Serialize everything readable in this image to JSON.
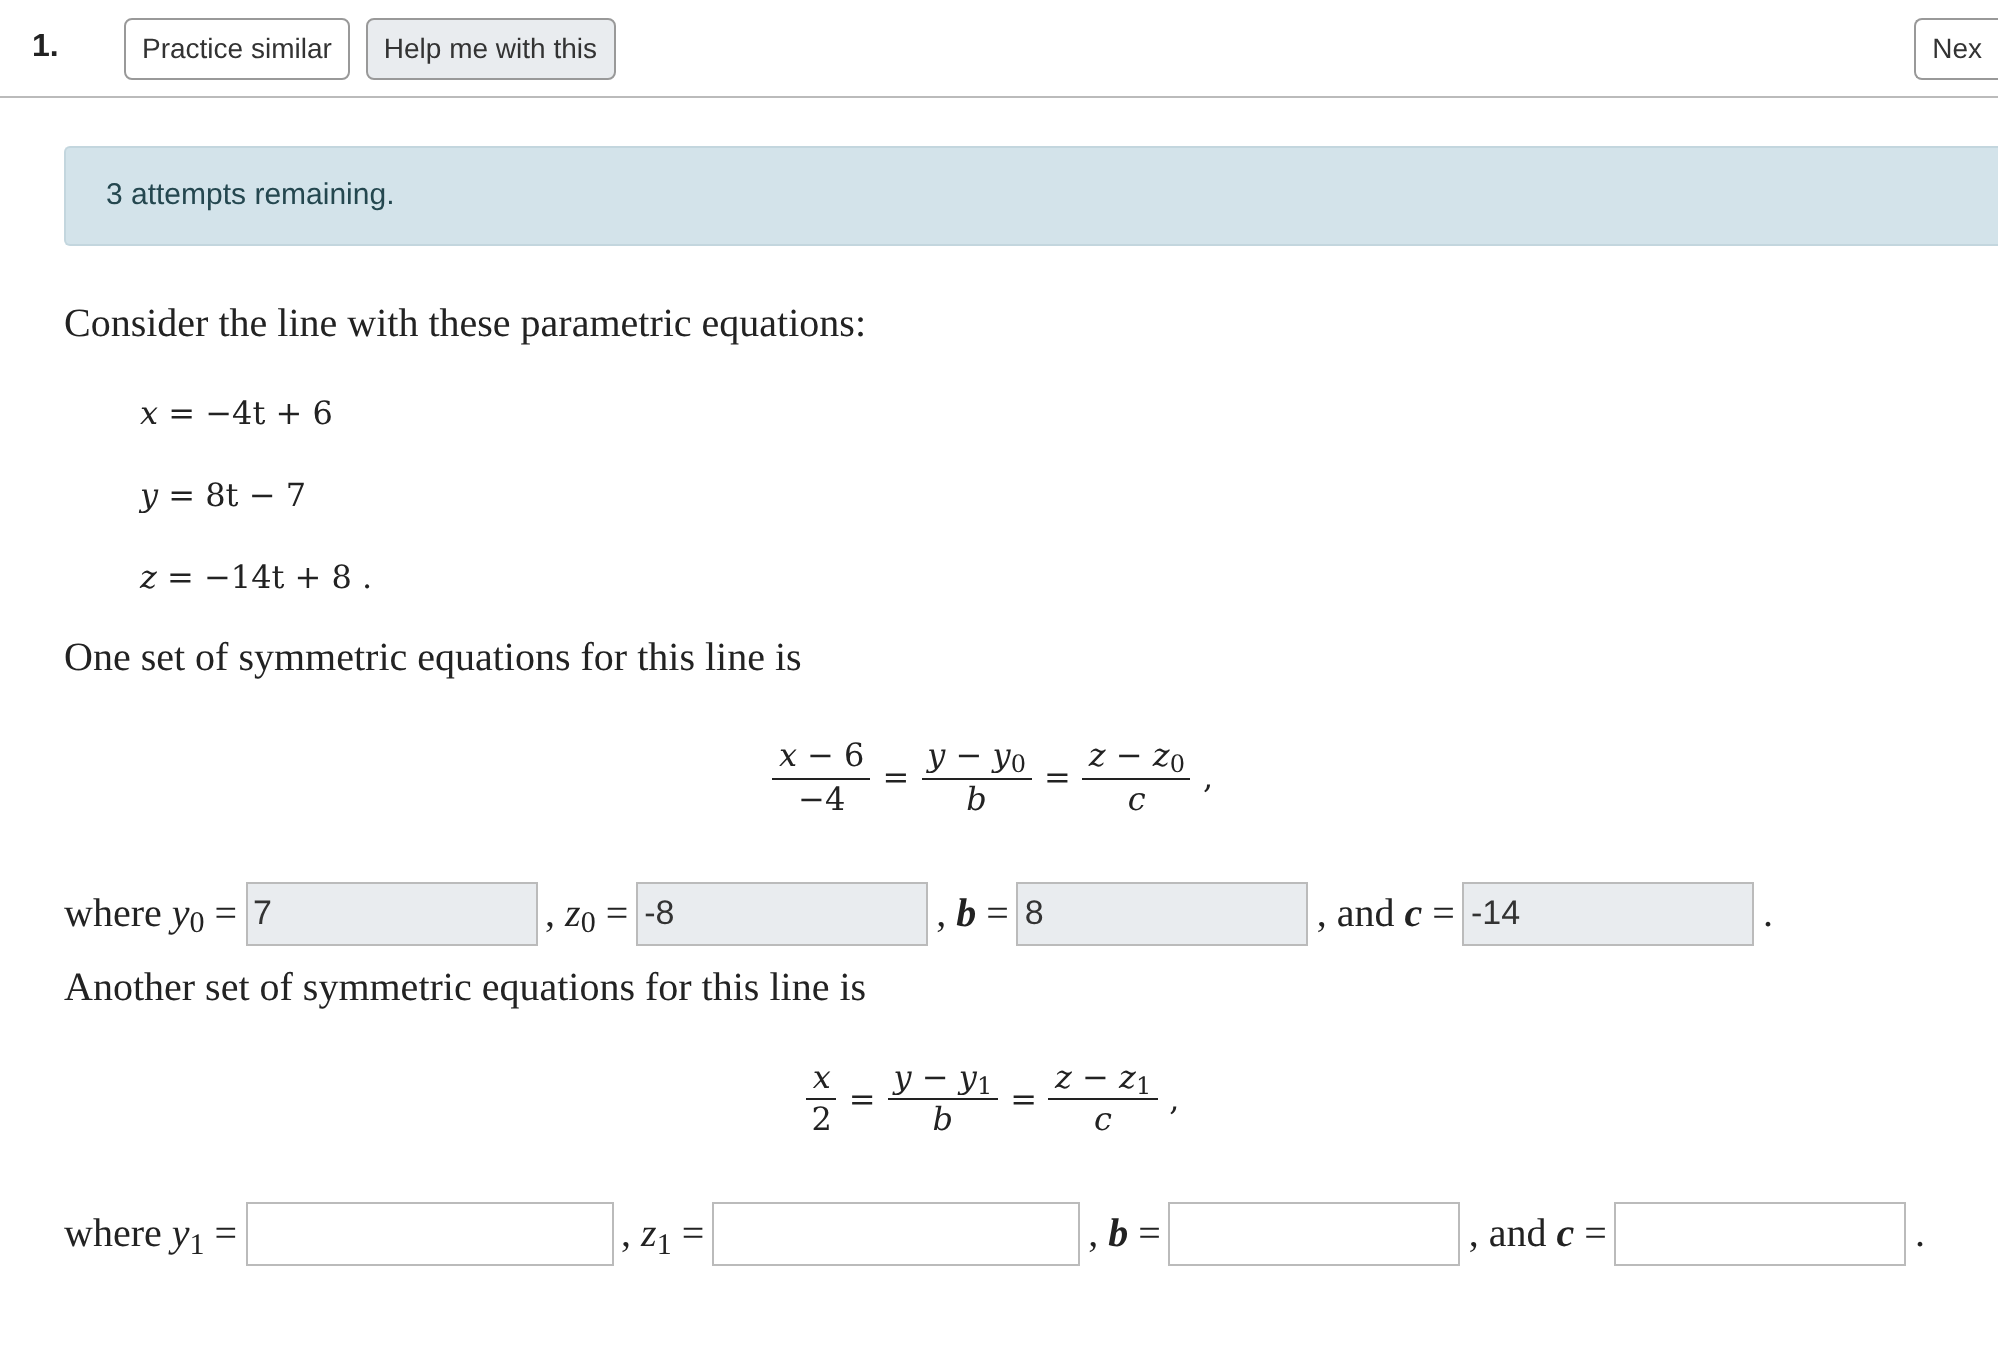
{
  "header": {
    "number": "1.",
    "buttons": [
      {
        "label": "Practice similar",
        "kind": "outline"
      },
      {
        "label": "Help me with this",
        "kind": "filled"
      }
    ],
    "next_button": "Nex"
  },
  "alert": "3 attempts remaining.",
  "intro": "Consider the line with these parametric equations:",
  "equations": [
    "*x* = −4t + 6",
    "*y* = 8t − 7",
    "*z* = −14t + 8 ."
  ],
  "sets": [
    {
      "lead": "One set of symmetric equations for this line is",
      "parts": [
        {
          "kind": "fraction",
          "num": "*x* − 6",
          "den": "−4"
        },
        {
          "kind": "op",
          "text": "="
        },
        {
          "kind": "fraction",
          "num": "*y* − *y*$_{0}$",
          "den": "*b*"
        },
        {
          "kind": "op",
          "text": "="
        },
        {
          "kind": "fraction",
          "num": "*z* − *z*$_{0}$",
          "den": "*c*"
        },
        {
          "kind": "op",
          "text": ","
        }
      ],
      "answers": [
        {
          "label": "where *y*$_{0}$ =",
          "value": "7",
          "disabled": true
        },
        {
          "label": ", *z*$_{0}$ =",
          "value": "-8",
          "disabled": true
        },
        {
          "label": ", **b** =",
          "value": "8",
          "disabled": true
        },
        {
          "label": ", and **c** =",
          "value": "-14",
          "disabled": true
        }
      ],
      "end": "."
    },
    {
      "lead": "Another set of symmetric equations for this line is",
      "parts": [
        {
          "kind": "fraction",
          "num": "*x*",
          "den": "2"
        },
        {
          "kind": "op",
          "text": "="
        },
        {
          "kind": "fraction",
          "num": "*y* − *y*$_{1}$",
          "den": "*b*"
        },
        {
          "kind": "op",
          "text": "="
        },
        {
          "kind": "fraction",
          "num": "*z* − *z*$_{1}$",
          "den": "*c*"
        },
        {
          "kind": "op",
          "text": ","
        }
      ],
      "answers": [
        {
          "label": "where *y*$_{1}$ =",
          "disabled": false
        },
        {
          "label": ", *z*$_{1}$ =",
          "disabled": false
        },
        {
          "label": ", **b** =",
          "disabled": false
        },
        {
          "label": ", and **c** =",
          "disabled": false
        }
      ],
      "end": "."
    }
  ]
}
